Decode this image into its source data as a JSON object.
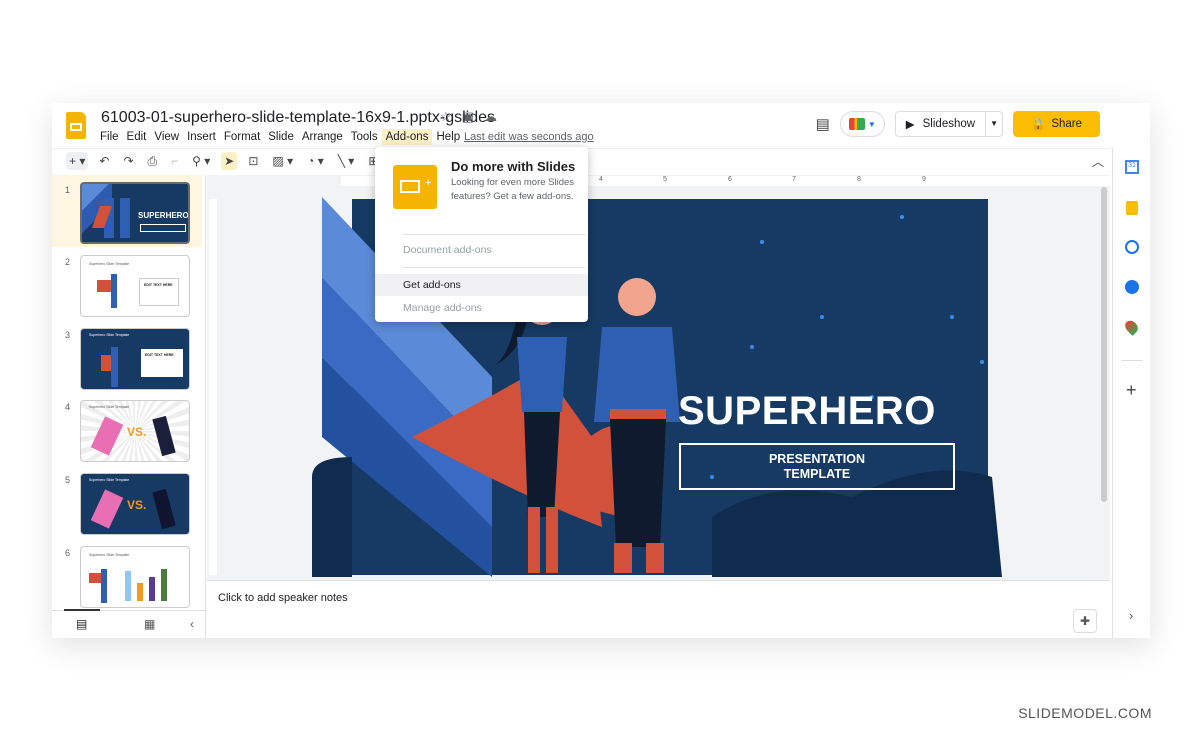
{
  "file": {
    "title": "61003-01-superhero-slide-template-16x9-1.pptx-gslides",
    "last_edit": "Last edit was seconds ago"
  },
  "menu": [
    "File",
    "Edit",
    "View",
    "Insert",
    "Format",
    "Slide",
    "Arrange",
    "Tools",
    "Add-ons",
    "Help"
  ],
  "header": {
    "slideshow": "Slideshow",
    "share": "Share"
  },
  "addons_menu": {
    "title": "Do more with Slides",
    "description": "Looking for even more Slides features? Get a few add-ons.",
    "items": [
      {
        "label": "Document add-ons",
        "enabled": false
      },
      {
        "label": "Get add-ons",
        "enabled": true
      },
      {
        "label": "Manage add-ons",
        "enabled": false
      }
    ]
  },
  "ruler": [
    "4",
    "5",
    "6",
    "7",
    "8",
    "9"
  ],
  "slides": [
    {
      "n": "1",
      "title": ""
    },
    {
      "n": "2",
      "title": "Superhero Slide Template",
      "box": "EDIT TEXT HERE"
    },
    {
      "n": "3",
      "title": "Superhero Slide Template",
      "box": "EDIT TEXT HERE"
    },
    {
      "n": "4",
      "title": "Superhero Slide Template",
      "vs": "VS."
    },
    {
      "n": "5",
      "title": "Superhero Slide Template",
      "vs": "VS."
    },
    {
      "n": "6",
      "title": "Superhero Slide Template"
    }
  ],
  "main_slide": {
    "title": "SUPERHERO",
    "subtitle_line1": "PRESENTATION",
    "subtitle_line2": "TEMPLATE",
    "thumb_title": "SUPERHERO"
  },
  "notes": {
    "placeholder": "Click to add speaker notes"
  },
  "watermark": "SLIDEMODEL.COM",
  "colors": {
    "accent": "#fbbc04",
    "slide_bg": "#163a63",
    "cape": "#d2513a",
    "suit": "#2f5fb3"
  }
}
